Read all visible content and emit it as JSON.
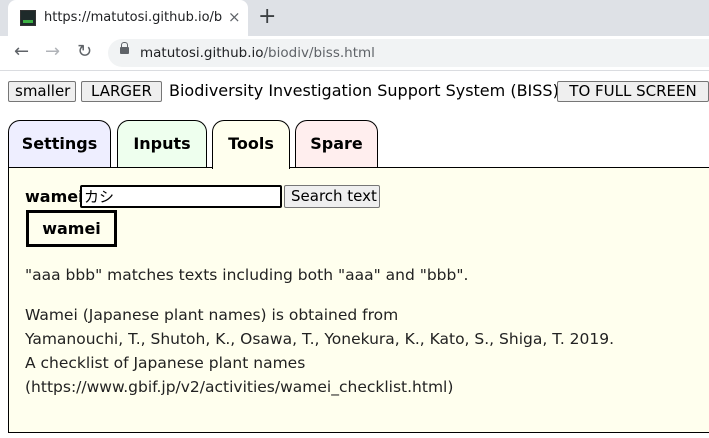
{
  "browser": {
    "tab_title": "https://matutosi.github.io/biodiv",
    "tab_close": "×",
    "new_tab": "+",
    "back": "←",
    "forward": "→",
    "reload": "↻",
    "url_host": "matutosi.github.io",
    "url_path": "/biodiv/biss.html"
  },
  "header": {
    "smaller_label": "smaller",
    "larger_label": "LARGER",
    "title": "Biodiversity Investigation Support System (BISS)",
    "fullscreen_label": "TO FULL SCREEN"
  },
  "tabs": [
    {
      "label": "Settings",
      "color": "#eeeeff"
    },
    {
      "label": "Inputs",
      "color": "#eeffee"
    },
    {
      "label": "Tools",
      "color": "#ffffee"
    },
    {
      "label": "Spare",
      "color": "#ffeeee"
    }
  ],
  "tools": {
    "field_label": "wamei",
    "input_value": "カシ",
    "search_label": "Search text",
    "result_tag": "wamei",
    "match_note": "\"aaa bbb\" matches texts including both \"aaa\" and \"bbb\".",
    "source": [
      "Wamei (Japanese plant names) is obtained from",
      "Yamanouchi, T., Shutoh, K., Osawa, T., Yonekura, K., Kato, S., Shiga, T. 2019.",
      "A checklist of Japanese plant names",
      "(https://www.gbif.jp/v2/activities/wamei_checklist.html)"
    ]
  },
  "colors": {
    "panel_bg": "#ffffee",
    "active_tab": "Tools"
  }
}
